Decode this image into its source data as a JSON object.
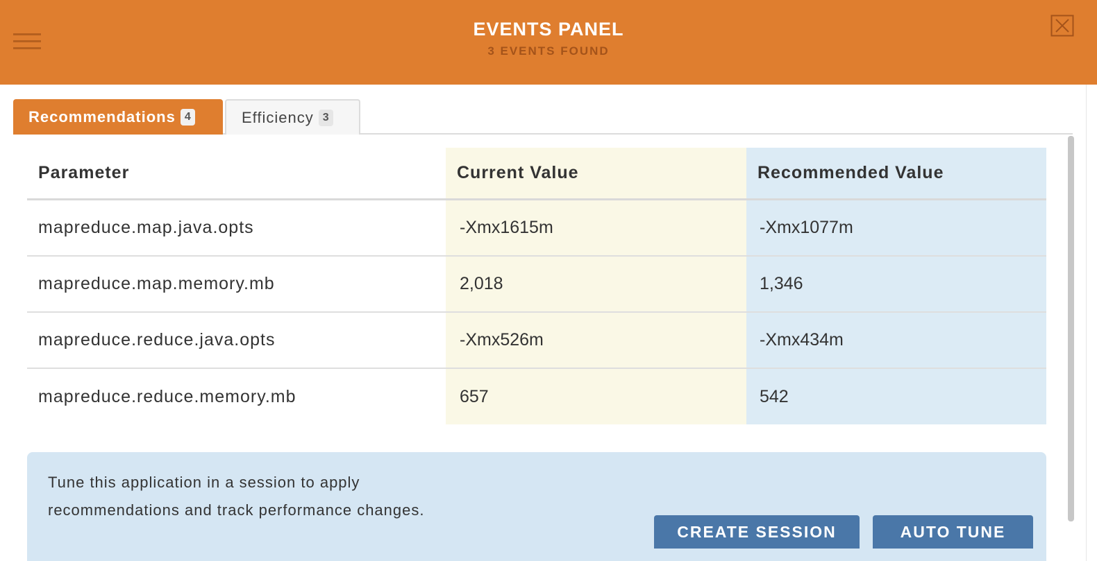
{
  "header": {
    "title": "EVENTS PANEL",
    "subtitle": "3 EVENTS FOUND"
  },
  "tabs": [
    {
      "label": "Recommendations",
      "count": "4",
      "active": true
    },
    {
      "label": "Efficiency",
      "count": "3",
      "active": false
    }
  ],
  "table": {
    "headers": {
      "parameter": "Parameter",
      "current": "Current Value",
      "recommended": "Recommended Value"
    },
    "rows": [
      {
        "parameter": "mapreduce.map.java.opts",
        "current": "-Xmx1615m",
        "recommended": "-Xmx1077m"
      },
      {
        "parameter": "mapreduce.map.memory.mb",
        "current": "2,018",
        "recommended": "1,346"
      },
      {
        "parameter": "mapreduce.reduce.java.opts",
        "current": "-Xmx526m",
        "recommended": "-Xmx434m"
      },
      {
        "parameter": "mapreduce.reduce.memory.mb",
        "current": "657",
        "recommended": "542"
      }
    ]
  },
  "notice": {
    "line1": "Tune this application in a session to apply",
    "line2": "recommendations and track performance changes."
  },
  "buttons": {
    "create_session": "CREATE SESSION",
    "auto_tune": "AUTO TUNE"
  },
  "colors": {
    "header": "#df7e2f",
    "current_col": "#faf8e6",
    "recommended_col": "#dcebf5",
    "button": "#4a77a8"
  },
  "icons": {
    "menu": "hamburger-menu-icon",
    "close": "close-icon"
  }
}
